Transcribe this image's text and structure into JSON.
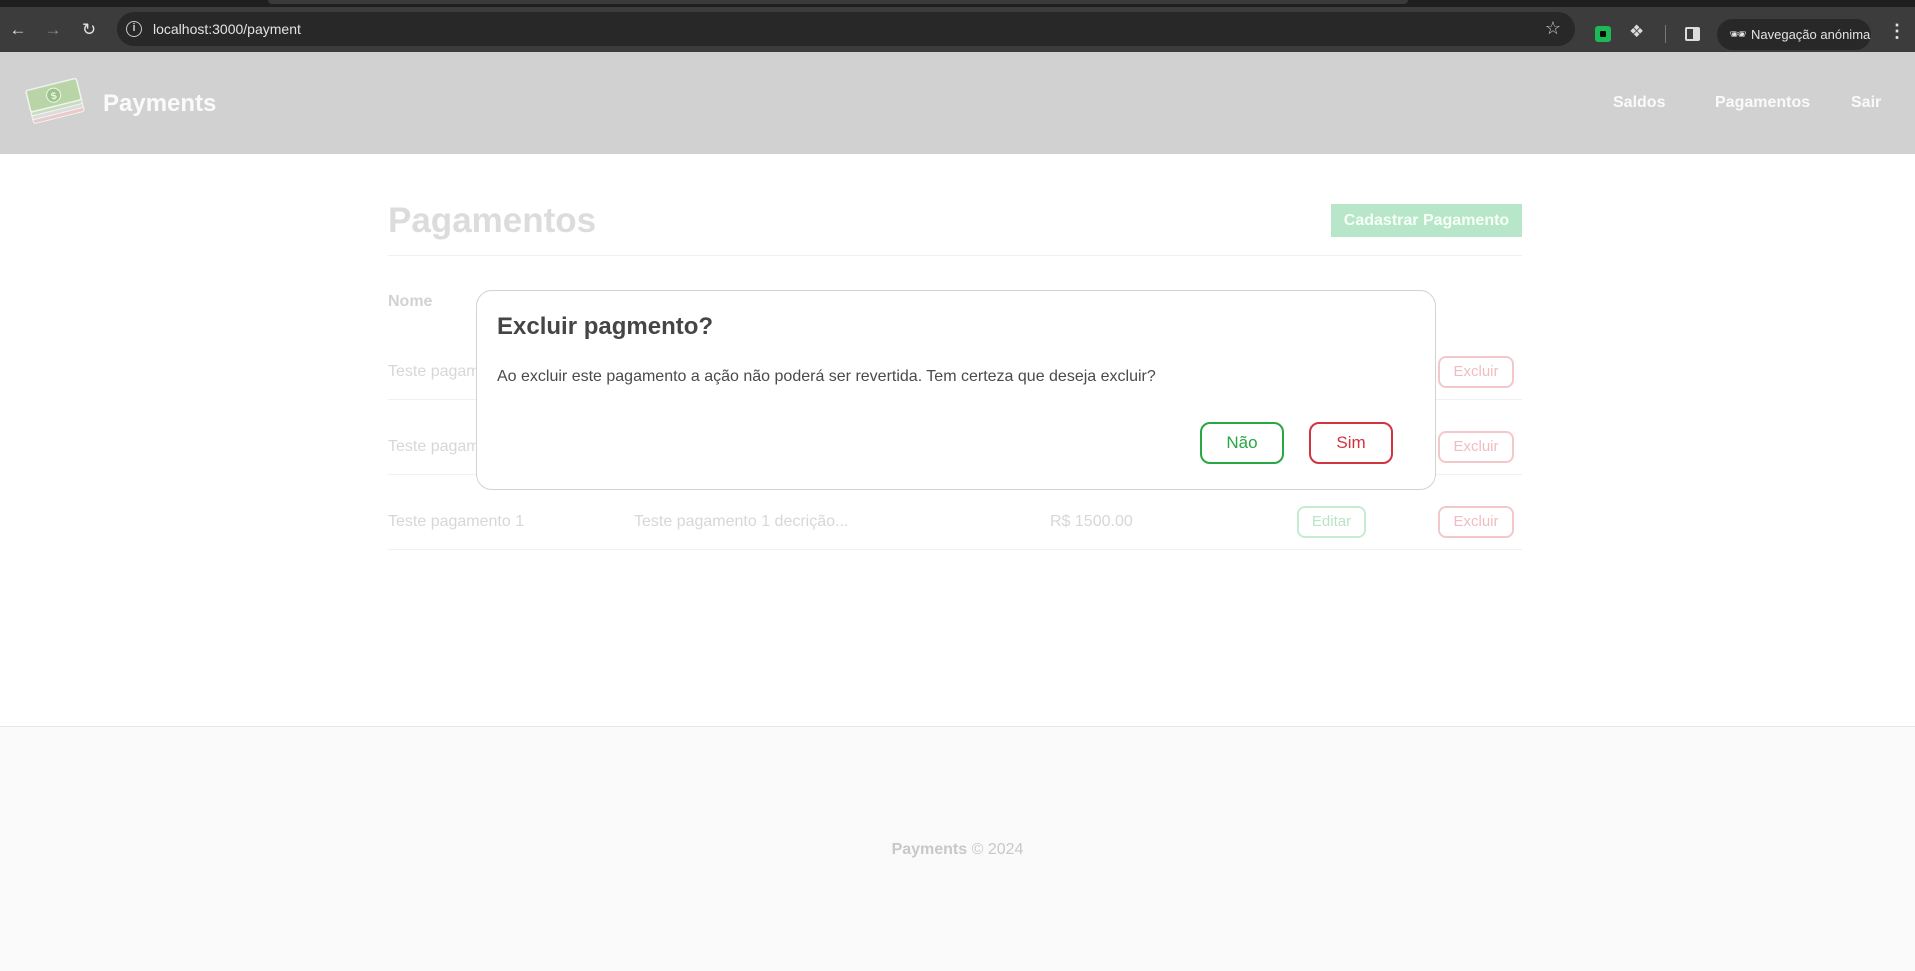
{
  "browser": {
    "url": "localhost:3000/payment",
    "incognito_label": "Navegação anónima"
  },
  "header": {
    "brand": "Payments",
    "nav": [
      "Saldos",
      "Pagamentos",
      "Sair"
    ]
  },
  "main": {
    "title": "Pagamentos",
    "add_button": "Cadastrar Pagamento",
    "column_name": "Nome",
    "rows": [
      {
        "name": "Teste pagam"
      },
      {
        "name": "Teste pagam"
      },
      {
        "name": "Teste pagamento 1",
        "description": "Teste pagamento 1 decrição...",
        "amount": "R$ 1500.00"
      }
    ],
    "edit_label": "Editar",
    "delete_label": "Excluir"
  },
  "footer": {
    "brand": "Payments",
    "suffix": " © 2024"
  },
  "modal": {
    "title": "Excluir pagmento?",
    "message": "Ao excluir este pagamento a ação não poderá ser revertida. Tem certeza que deseja excluir?",
    "no_label": "Não",
    "yes_label": "Sim"
  },
  "colors": {
    "success": "#28a745",
    "danger": "#d0343f",
    "header_bg": "#d1d1d1"
  }
}
